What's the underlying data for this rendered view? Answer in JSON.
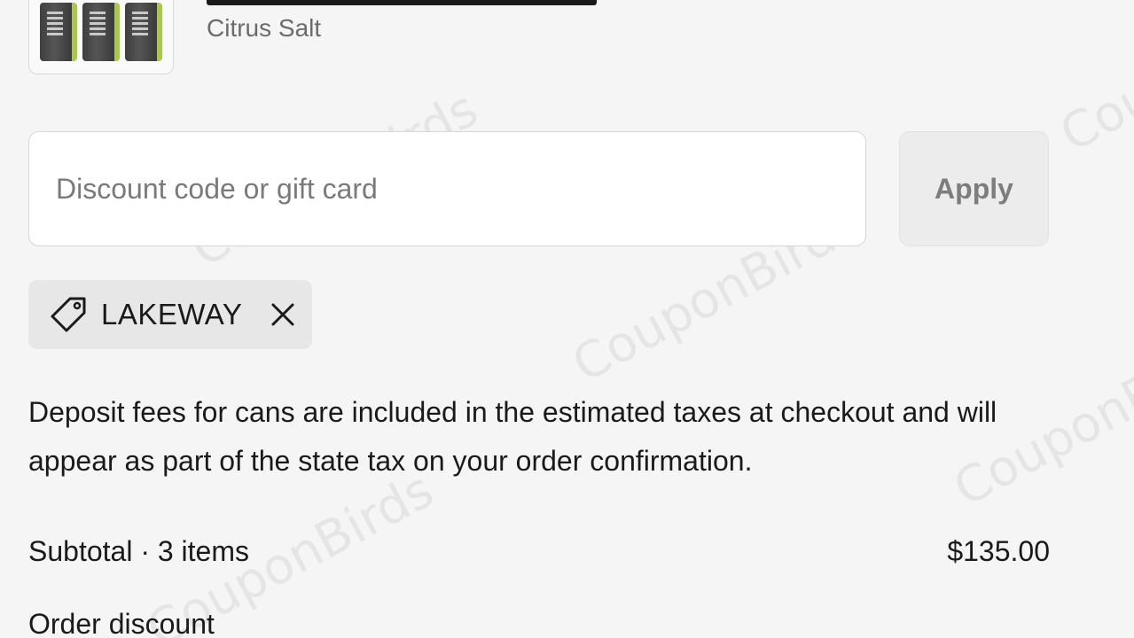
{
  "product": {
    "variant": "Citrus Salt"
  },
  "discount_form": {
    "placeholder": "Discount code or gift card",
    "value": "",
    "apply_label": "Apply"
  },
  "applied_code": {
    "code": "LAKEWAY",
    "icon": "tag-icon",
    "remove_icon": "close-icon"
  },
  "notice": {
    "text": "Deposit fees for cans are included in the estimated taxes at checkout and will appear as part of the state tax on your order confirmation."
  },
  "summary": {
    "subtotal_label": "Subtotal · 3 items",
    "subtotal_value": "$135.00",
    "discount_label": "Order discount"
  },
  "watermark": {
    "text": "CouponBirds"
  },
  "colors": {
    "background": "#f5f5f5",
    "text": "#1a1a1a",
    "muted": "#6b6b6b",
    "chip": "#e7e7e7",
    "can_accent": "#a9c64d"
  }
}
